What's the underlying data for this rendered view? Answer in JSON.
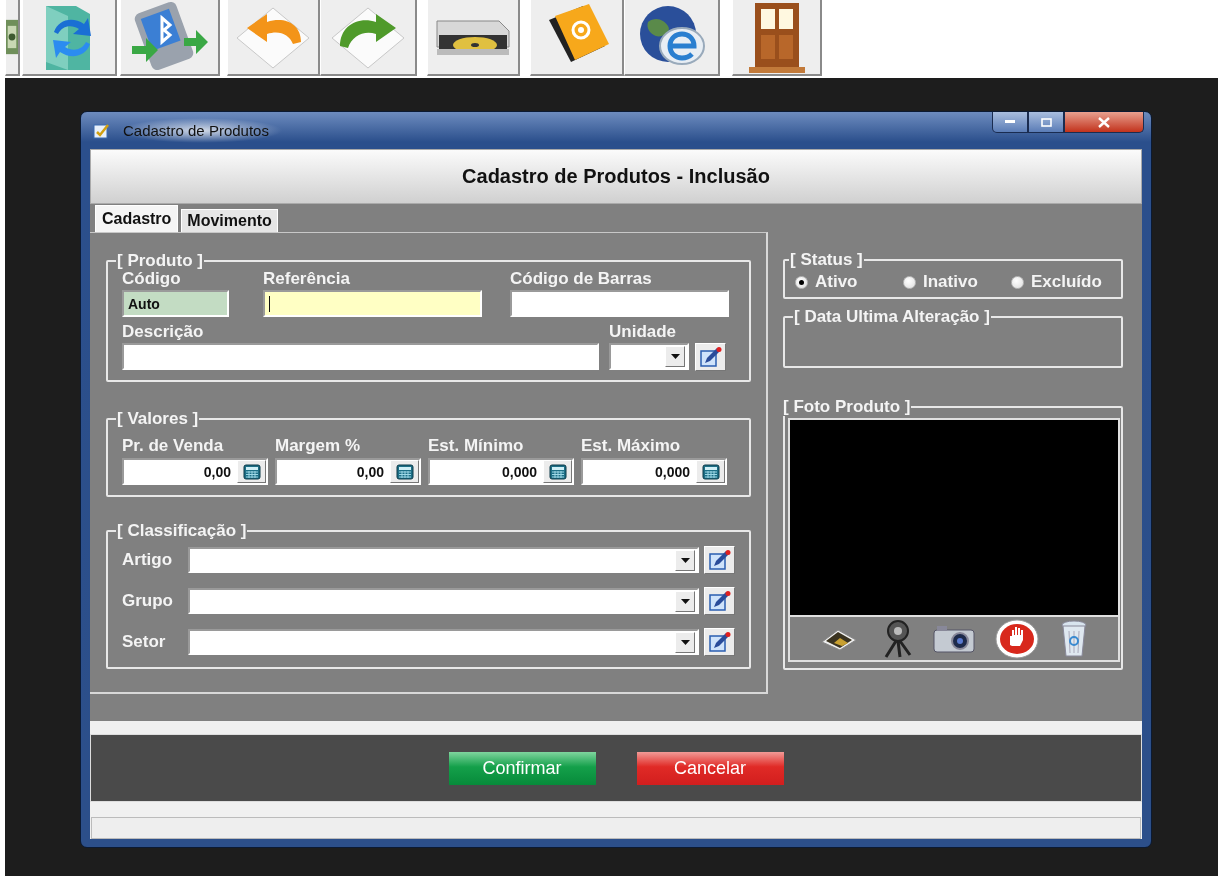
{
  "window": {
    "title": "Cadastro de Produtos"
  },
  "header": {
    "title": "Cadastro de Produtos - Inclusão"
  },
  "tabs": [
    {
      "label": "Cadastro",
      "selected": true
    },
    {
      "label": "Movimento",
      "selected": false
    }
  ],
  "produto": {
    "legend": "[ Produto ]",
    "fields": [
      {
        "label": "Código",
        "value": "Auto",
        "kind": "readonly"
      },
      {
        "label": "Referência",
        "kind": "focused"
      },
      {
        "label": "Código de Barras",
        "kind": "text"
      },
      {
        "label": "Descrição",
        "kind": "text"
      },
      {
        "label": "Unidade",
        "kind": "combo"
      }
    ]
  },
  "valores": {
    "legend": "[ Valores ]",
    "fields": [
      {
        "label": "Pr. de Venda",
        "value": "0,00"
      },
      {
        "label": "Margem %",
        "value": "0,00"
      },
      {
        "label": "Est. Mínimo",
        "value": "0,000"
      },
      {
        "label": "Est. Máximo",
        "value": "0,000"
      }
    ]
  },
  "classificacao": {
    "legend": "[ Classificação ]",
    "fields": [
      {
        "label": "Artigo"
      },
      {
        "label": "Grupo"
      },
      {
        "label": "Setor"
      }
    ]
  },
  "status": {
    "legend": "[ Status ]",
    "options": [
      {
        "label": "Ativo",
        "selected": true
      },
      {
        "label": "Inativo",
        "selected": false
      },
      {
        "label": "Excluído",
        "selected": false
      }
    ]
  },
  "data_alteracao": {
    "legend": "[ Data Ultima Alteração ]"
  },
  "foto": {
    "legend": "[ Foto Produto ]"
  },
  "buttons": [
    {
      "label": "Confirmar",
      "kind": "confirm"
    },
    {
      "label": "Cancelar",
      "kind": "cancel"
    }
  ]
}
